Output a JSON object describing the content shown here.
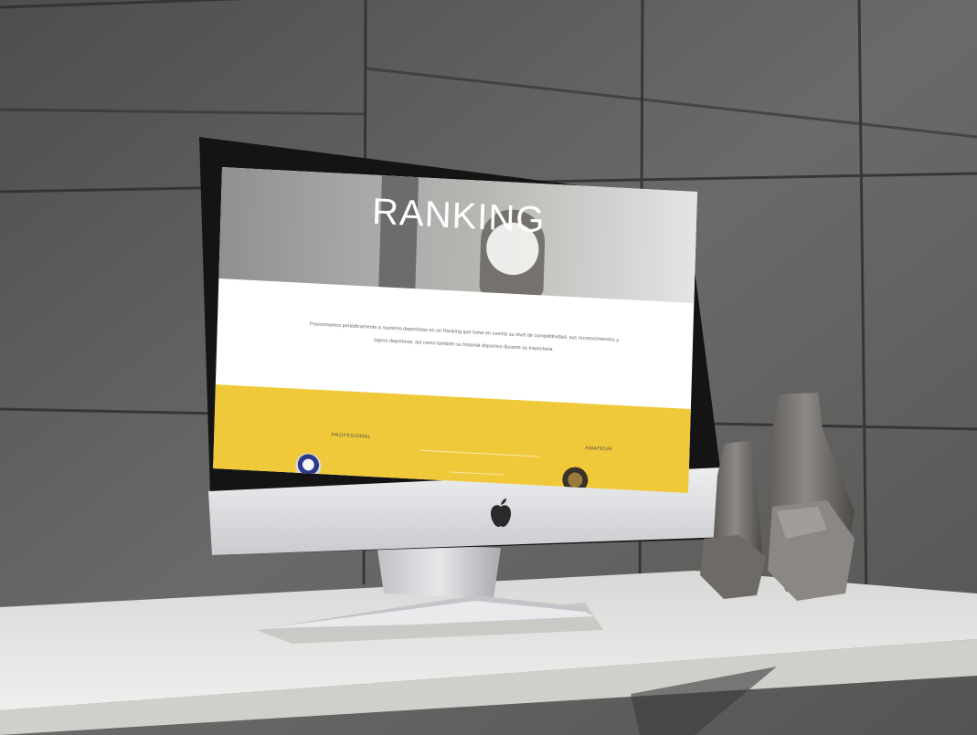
{
  "screen": {
    "hero_title": "RANKING",
    "description": "Posicionamos periódicamente a nuestros deportistas en un Ranking que toma en cuenta su nivel de competitividad, sus reconocimientos y logros deportivos, así como también su historial deportivo durante su trayectoria.",
    "category_left": "PROFESIONAL",
    "category_right": "AMATEUR"
  },
  "colors": {
    "accent_yellow": "#f0c93b",
    "wall": "#5b5b5a",
    "desk": "#e7e7e5",
    "monitor_chin": "#e3e4e6"
  },
  "icons": [
    "apple-logo-icon"
  ]
}
